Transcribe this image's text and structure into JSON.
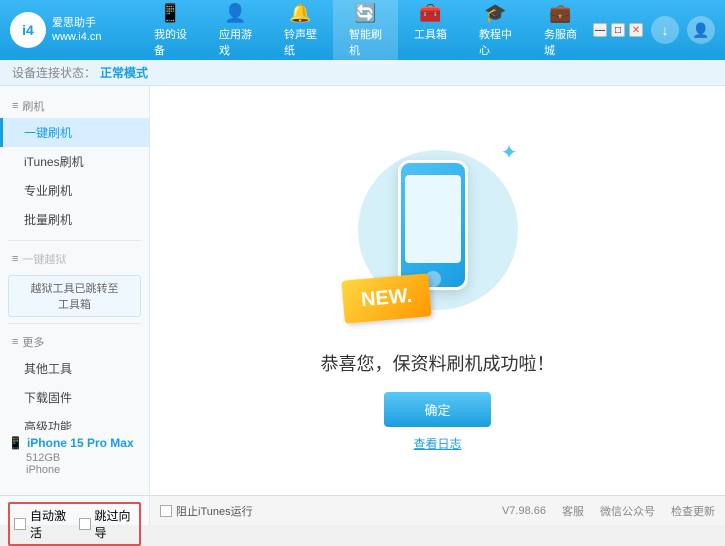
{
  "app": {
    "logo_id": "i4",
    "logo_sub": "www.i4.cn",
    "title": "爱思助手"
  },
  "nav": {
    "tabs": [
      {
        "id": "my-device",
        "icon": "📱",
        "label": "我的设备"
      },
      {
        "id": "apps-games",
        "icon": "👤",
        "label": "应用游戏"
      },
      {
        "id": "ringtone",
        "icon": "🔔",
        "label": "铃声壁纸"
      },
      {
        "id": "smart-flash",
        "icon": "🔄",
        "label": "智能刷机",
        "active": true
      },
      {
        "id": "toolbox",
        "icon": "🧰",
        "label": "工具箱"
      },
      {
        "id": "tutorial",
        "icon": "🎓",
        "label": "教程中心"
      },
      {
        "id": "service",
        "icon": "💼",
        "label": "务服商城"
      }
    ]
  },
  "status_bar": {
    "prefix": "设备连接状态：",
    "value": "正常模式"
  },
  "sidebar": {
    "sections": [
      {
        "title": "刷机",
        "icon": "≡",
        "items": [
          {
            "id": "one-click-flash",
            "label": "一键刷机",
            "active": true
          },
          {
            "id": "itunes-flash",
            "label": "iTunes刷机"
          },
          {
            "id": "pro-flash",
            "label": "专业刷机"
          },
          {
            "id": "batch-flash",
            "label": "批量刷机"
          }
        ]
      },
      {
        "title": "一键越狱",
        "icon": "≡",
        "disabled": true,
        "info_box": "越狱工具已跳转至\n工具箱"
      },
      {
        "title": "更多",
        "icon": "≡",
        "items": [
          {
            "id": "other-tools",
            "label": "其他工具"
          },
          {
            "id": "download-firmware",
            "label": "下载固件"
          },
          {
            "id": "advanced",
            "label": "高级功能"
          }
        ]
      }
    ]
  },
  "content": {
    "success_title": "恭喜您，保资料刷机成功啦！",
    "confirm_btn": "确定",
    "log_link": "查看日志",
    "new_badge": "NEW."
  },
  "device_panel": {
    "auto_activate_label": "自动激活",
    "skip_activation_label": "跳过向导",
    "device_icon": "📱",
    "device_name": "iPhone 15 Pro Max",
    "device_storage": "512GB",
    "device_type": "iPhone"
  },
  "bottom": {
    "stop_itunes_label": "阻止iTunes运行",
    "version": "V7.98.66",
    "links": [
      "客服",
      "微信公众号",
      "检查更新"
    ]
  }
}
